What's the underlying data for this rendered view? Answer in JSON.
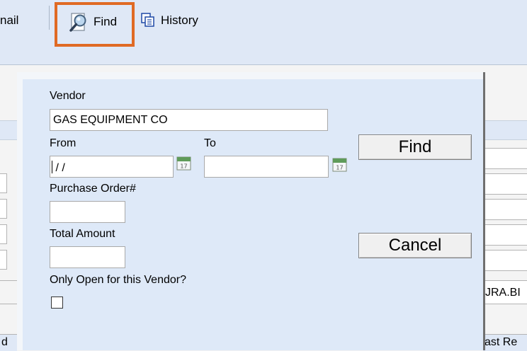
{
  "toolbar": {
    "email_label": "nail",
    "find_label": "Find",
    "history_label": "History"
  },
  "background": {
    "field_text_1": "JRA.BI",
    "field_text_2": "ast Re",
    "field_text_3": "d"
  },
  "dialog": {
    "vendor_label": "Vendor",
    "vendor_value": "GAS EQUIPMENT CO",
    "from_label": "From",
    "to_label": "To",
    "from_value": " / /",
    "to_value": "",
    "calendar_day": "17",
    "po_label": "Purchase Order#",
    "po_value": "",
    "total_label": "Total Amount",
    "total_value": "",
    "only_open_label": "Only Open for this Vendor?",
    "only_open_checked": false,
    "find_button": "Find",
    "cancel_button": "Cancel"
  },
  "colors": {
    "highlight": "#e06a24",
    "dialog_bg": "#dee9f8",
    "toolbar_bg": "#dfe8f6"
  }
}
